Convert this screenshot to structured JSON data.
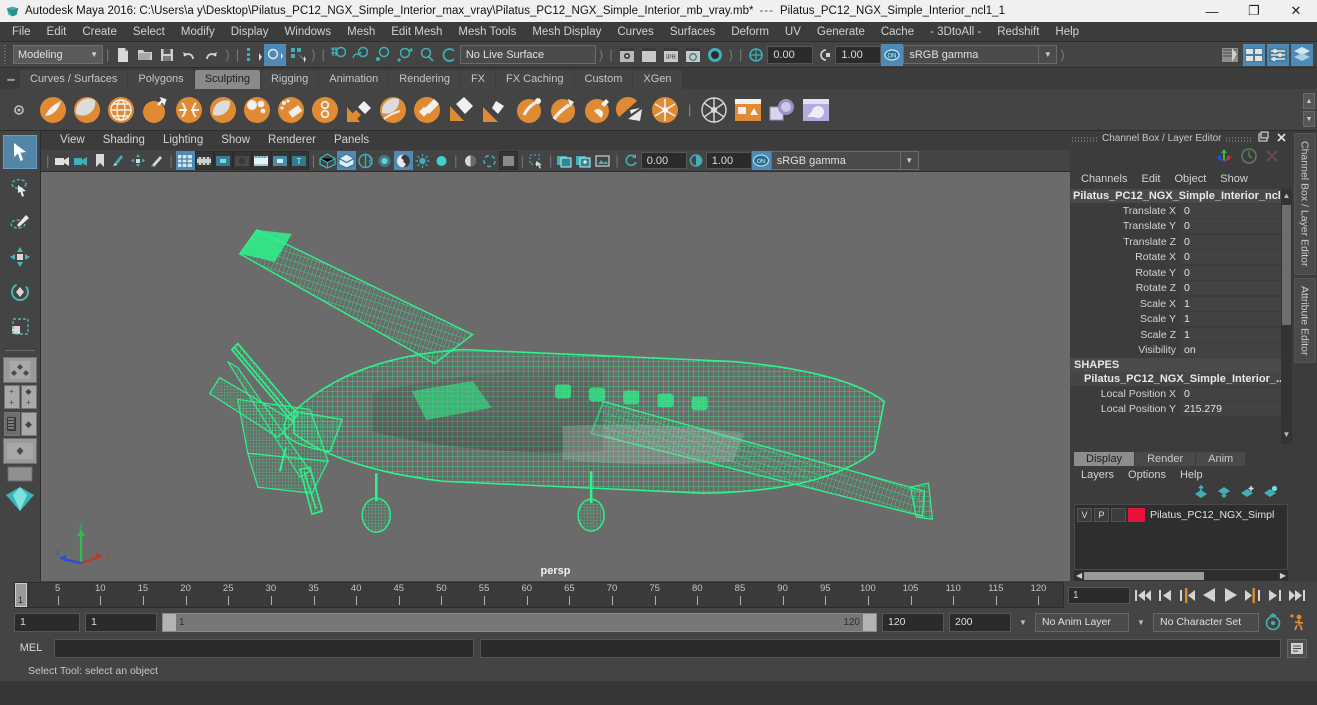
{
  "titlebar": {
    "app_title": "Autodesk Maya 2016: C:\\Users\\a y\\Desktop\\Pilatus_PC12_NGX_Simple_Interior_max_vray\\Pilatus_PC12_NGX_Simple_Interior_mb_vray.mb*",
    "separator": "---",
    "object_title": "Pilatus_PC12_NGX_Simple_Interior_ncl1_1",
    "minimize": "—",
    "maximize": "❐",
    "close": "✕"
  },
  "menubar": {
    "items": [
      "File",
      "Edit",
      "Create",
      "Select",
      "Modify",
      "Display",
      "Windows",
      "Mesh",
      "Edit Mesh",
      "Mesh Tools",
      "Mesh Display",
      "Curves",
      "Surfaces",
      "Deform",
      "UV",
      "Generate",
      "Cache",
      "- 3DtoAll -",
      "Redshift",
      "Help"
    ]
  },
  "statusline": {
    "mode_menu": "Modeling",
    "live_surface": "No Live Surface",
    "snap_value_1": "0.00",
    "snap_value_2": "1.00",
    "gamma_toggle": "ON",
    "color_management": "sRGB gamma"
  },
  "shelf": {
    "tabs": [
      {
        "label": "Curves / Surfaces",
        "active": false
      },
      {
        "label": "Polygons",
        "active": false
      },
      {
        "label": "Sculpting",
        "active": true
      },
      {
        "label": "Rigging",
        "active": false
      },
      {
        "label": "Animation",
        "active": false
      },
      {
        "label": "Rendering",
        "active": false
      },
      {
        "label": "FX",
        "active": false
      },
      {
        "label": "FX Caching",
        "active": false
      },
      {
        "label": "Custom",
        "active": false
      },
      {
        "label": "XGen",
        "active": false
      }
    ],
    "tools": [
      "sculpt-tool",
      "smooth-tool",
      "relax-tool",
      "grab-tool",
      "pinch-tool",
      "flatten-tool",
      "foamy-tool",
      "spray-tool",
      "repeat-tool",
      "imprint-tool",
      "wax-tool",
      "scrape-tool",
      "fill-tool",
      "knife-tool",
      "smear-tool",
      "bulge-tool",
      "amplify-tool",
      "freeze-tool",
      "freeze-select-tool",
      "convert-tool",
      "mirror-tool",
      "clone-tool"
    ]
  },
  "left_toolbar": {
    "tools": [
      "select-tool",
      "lasso-select-tool",
      "paint-select-tool",
      "move-tool",
      "rotate-tool",
      "scale-tool",
      "last-tool",
      "quick-layout-four",
      "quick-layout-persp",
      "quick-layout-outliner",
      "quick-layout-single",
      "quick-layout-hypershade"
    ]
  },
  "viewport": {
    "menus": [
      "View",
      "Shading",
      "Lighting",
      "Show",
      "Renderer",
      "Panels"
    ],
    "camera_label": "persp",
    "axis": {
      "x": "x",
      "y": "y",
      "z": "z"
    },
    "wireframe_color": "#2ef28a",
    "background_color": "#6b6b6b"
  },
  "channel_box": {
    "panel_title": "Channel Box / Layer Editor",
    "menus": [
      "Channels",
      "Edit",
      "Object",
      "Show"
    ],
    "object_name": "Pilatus_PC12_NGX_Simple_Interior_ncl...",
    "transform_attrs": [
      {
        "label": "Translate X",
        "value": "0"
      },
      {
        "label": "Translate Y",
        "value": "0"
      },
      {
        "label": "Translate Z",
        "value": "0"
      },
      {
        "label": "Rotate X",
        "value": "0"
      },
      {
        "label": "Rotate Y",
        "value": "0"
      },
      {
        "label": "Rotate Z",
        "value": "0"
      },
      {
        "label": "Scale X",
        "value": "1"
      },
      {
        "label": "Scale Y",
        "value": "1"
      },
      {
        "label": "Scale Z",
        "value": "1"
      },
      {
        "label": "Visibility",
        "value": "on"
      }
    ],
    "shapes_header": "SHAPES",
    "shape_name": "Pilatus_PC12_NGX_Simple_Interior_...",
    "shape_attrs": [
      {
        "label": "Local Position X",
        "value": "0"
      },
      {
        "label": "Local Position Y",
        "value": "215.279"
      }
    ],
    "vertical_tabs": [
      "Channel Box / Layer Editor",
      "Attribute Editor"
    ]
  },
  "layer_editor": {
    "tabs": [
      {
        "label": "Display",
        "active": true
      },
      {
        "label": "Render",
        "active": false
      },
      {
        "label": "Anim",
        "active": false
      }
    ],
    "menus": [
      "Layers",
      "Options",
      "Help"
    ],
    "layers": [
      {
        "visibility": "V",
        "playback": "P",
        "type": "",
        "color": "#e8113d",
        "name": "Pilatus_PC12_NGX_Simpl"
      }
    ]
  },
  "timeline": {
    "ticks": [
      5,
      10,
      15,
      20,
      25,
      30,
      35,
      40,
      45,
      50,
      55,
      60,
      65,
      70,
      75,
      80,
      85,
      90,
      95,
      100,
      105,
      110,
      115,
      120
    ],
    "current_frame": "1",
    "current_frame_field": "1",
    "playback_buttons": [
      "go-to-start",
      "step-back-key",
      "step-back-frame",
      "play-backwards",
      "play-forwards",
      "step-forward-frame",
      "step-forward-key",
      "go-to-end"
    ]
  },
  "range_row": {
    "anim_start": "1",
    "playback_start": "1",
    "range_left_value": "1",
    "range_right_value": "120",
    "playback_end": "120",
    "anim_end": "200",
    "anim_layer": "No Anim Layer",
    "character_set": "No Character Set",
    "buttons": [
      "auto-keyframe-toggle",
      "animation-preferences"
    ]
  },
  "command_line": {
    "language_label": "MEL",
    "input_value": "",
    "output_value": "",
    "script_editor_button": "script-editor-icon"
  },
  "help_line": {
    "text": "Select Tool: select an object"
  }
}
